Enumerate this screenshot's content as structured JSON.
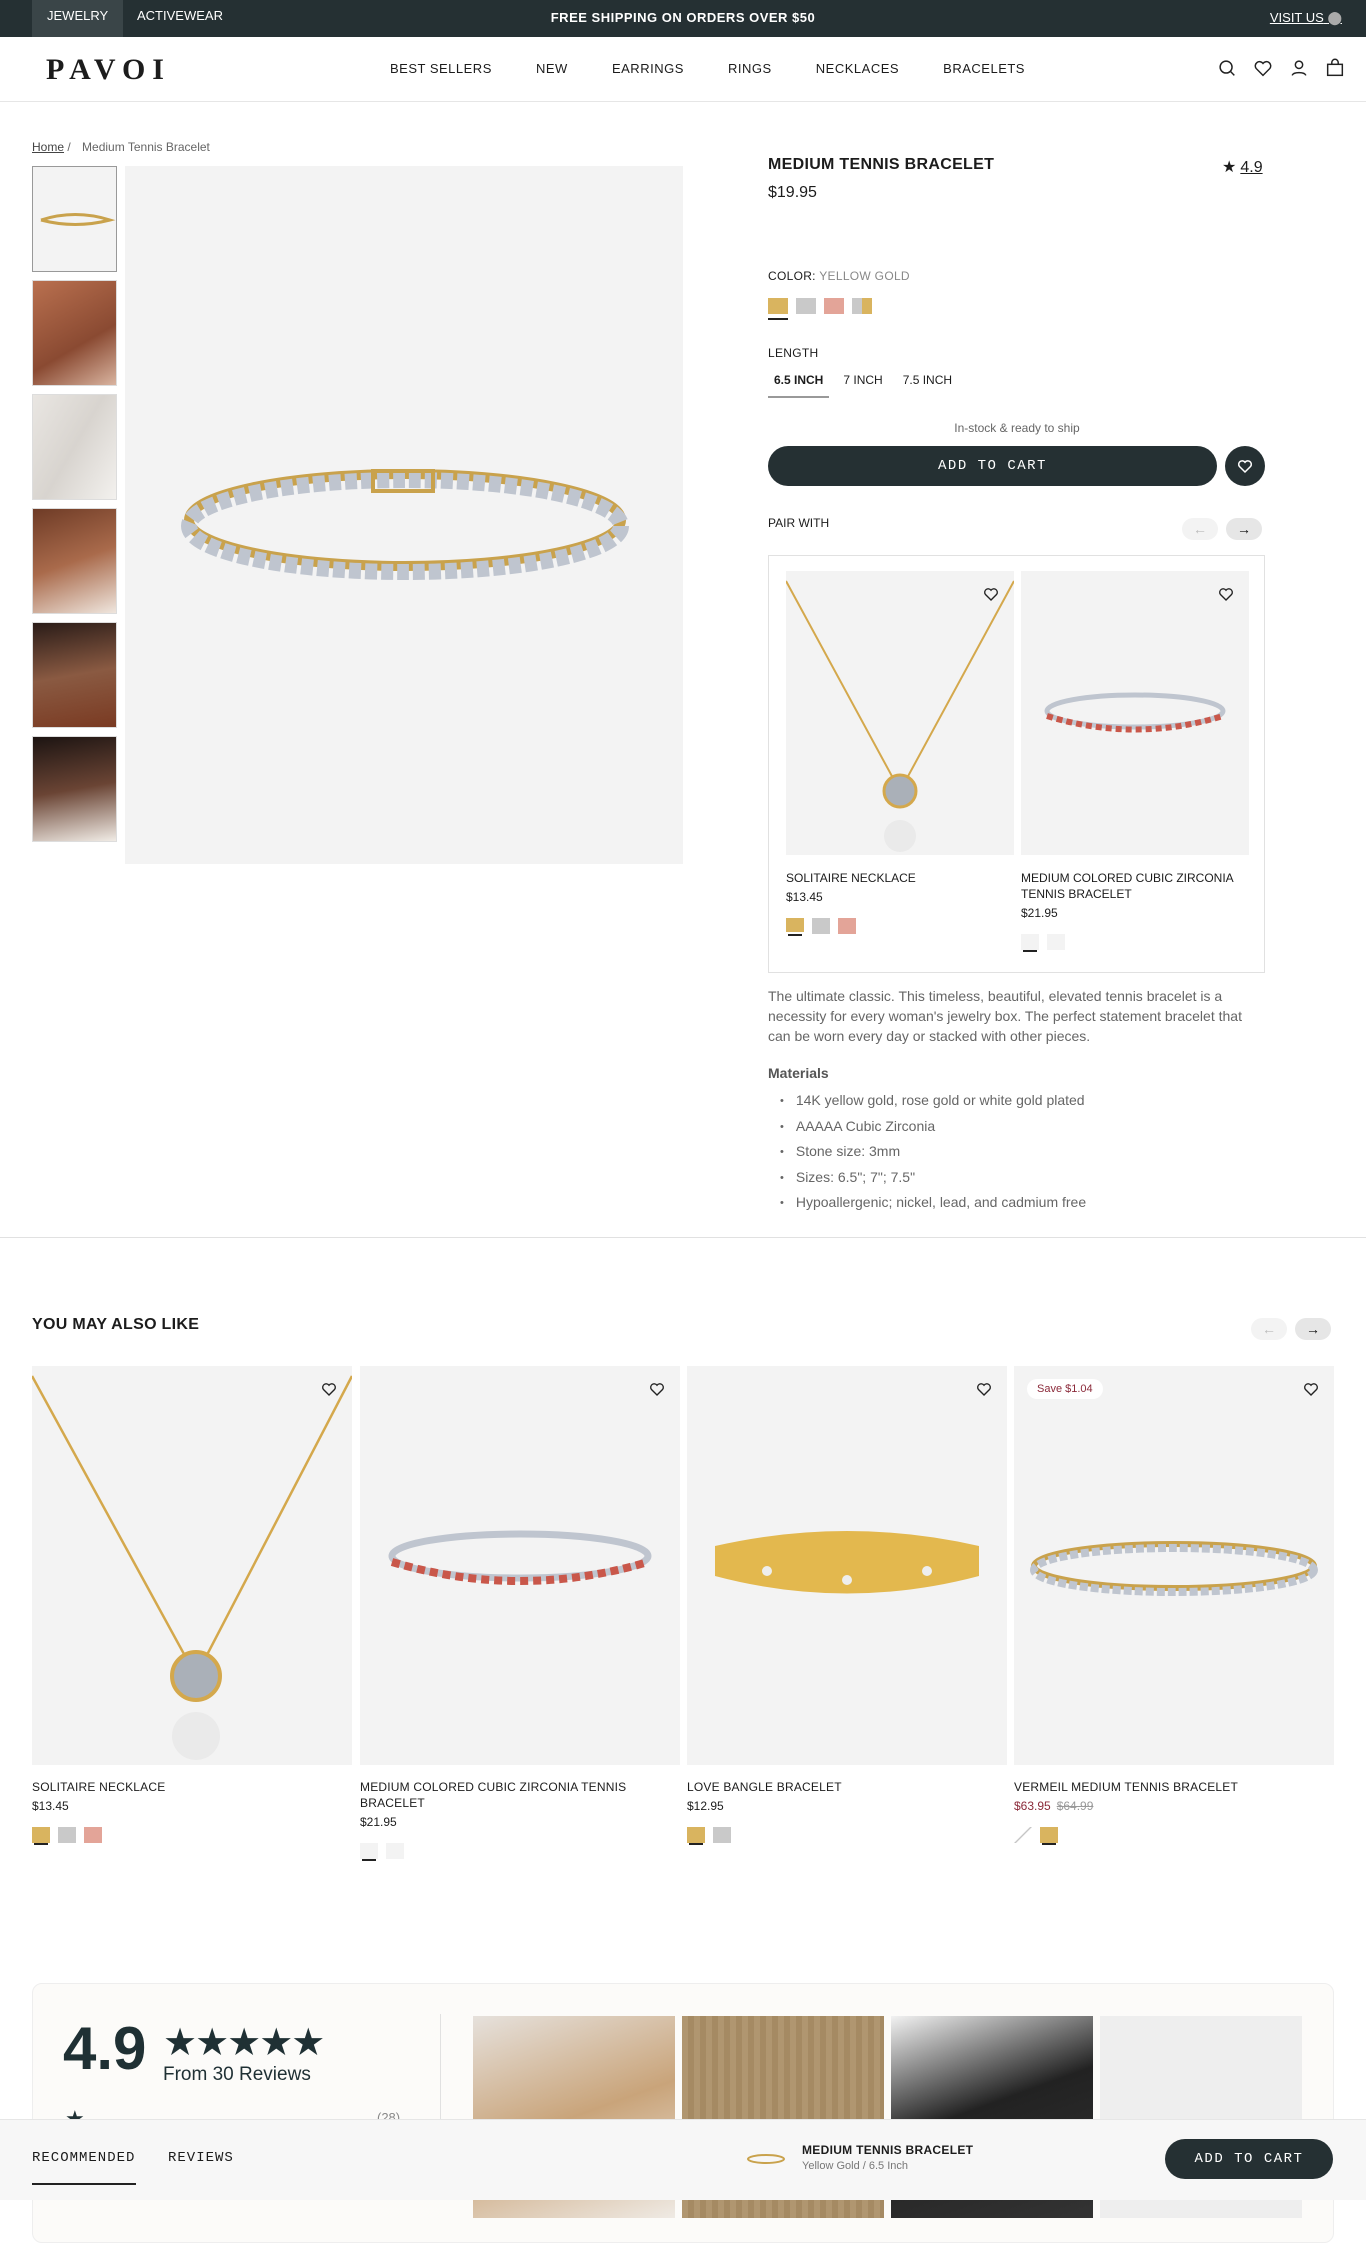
{
  "topbar": {
    "tabs": [
      "JEWELRY",
      "ACTIVEWEAR"
    ],
    "promo": "FREE SHIPPING ON ORDERS OVER $50",
    "visit": "VISIT US"
  },
  "header": {
    "logo": "PAVOI",
    "nav": [
      "BEST SELLERS",
      "NEW",
      "EARRINGS",
      "RINGS",
      "NECKLACES",
      "BRACELETS"
    ],
    "icons": [
      "search-icon",
      "heart-icon",
      "account-icon",
      "bag-icon"
    ]
  },
  "breadcrumb": {
    "home": "Home",
    "sep": "/",
    "current": "Medium Tennis Bracelet"
  },
  "product": {
    "title": "MEDIUM TENNIS BRACELET",
    "price": "$19.95",
    "rating": "4.9",
    "color_label": "COLOR:",
    "color_value": "YELLOW GOLD",
    "swatches": [
      "#d9b45f",
      "#c9c9c9",
      "#e3a498",
      "#b7a97a"
    ],
    "length_label": "LENGTH",
    "lengths": [
      "6.5 INCH",
      "7 INCH",
      "7.5 INCH"
    ],
    "stock": "In-stock & ready to ship",
    "add_to_cart": "ADD TO CART",
    "pair_with": "PAIR WITH",
    "description": "The ultimate classic. This timeless, beautiful, elevated tennis bracelet is a necessity for every woman's jewelry box. The perfect statement bracelet that can be worn every day or stacked with other pieces.",
    "materials_title": "Materials",
    "materials": [
      "14K yellow gold, rose gold or white gold plated",
      "AAAAA Cubic Zirconia",
      "Stone size: 3mm",
      "Sizes: 6.5\"; 7\"; 7.5\"",
      "Hypoallergenic; nickel, lead, and cadmium free"
    ]
  },
  "pair": [
    {
      "name": "SOLITAIRE NECKLACE",
      "price": "$13.45"
    },
    {
      "name": "MEDIUM COLORED CUBIC ZIRCONIA TENNIS BRACELET",
      "price": "$21.95"
    }
  ],
  "recommend": {
    "title": "YOU MAY ALSO LIKE",
    "items": [
      {
        "name": "SOLITAIRE NECKLACE",
        "price": "$13.45"
      },
      {
        "name": "MEDIUM COLORED CUBIC ZIRCONIA TENNIS BRACELET",
        "price": "$21.95"
      },
      {
        "name": "LOVE BANGLE BRACELET",
        "price": "$12.95"
      },
      {
        "name": "VERMEIL MEDIUM TENNIS BRACELET",
        "price": "$63.95",
        "compare": "$64.99",
        "badge": "Save $1.04"
      }
    ]
  },
  "reviews": {
    "score": "4.9",
    "stars": "★★★★★",
    "count_text": "From 30 Reviews",
    "first_bar_count": "(28)"
  },
  "sticky": {
    "tabs": [
      "RECOMMENDED",
      "REVIEWS"
    ],
    "name": "MEDIUM TENNIS BRACELET",
    "variant": "Yellow Gold / 6.5 Inch",
    "cta": "ADD TO CART"
  },
  "colors": {
    "dark": "#253033",
    "sale": "#8b2a3a",
    "gold": "#d9b45f"
  }
}
